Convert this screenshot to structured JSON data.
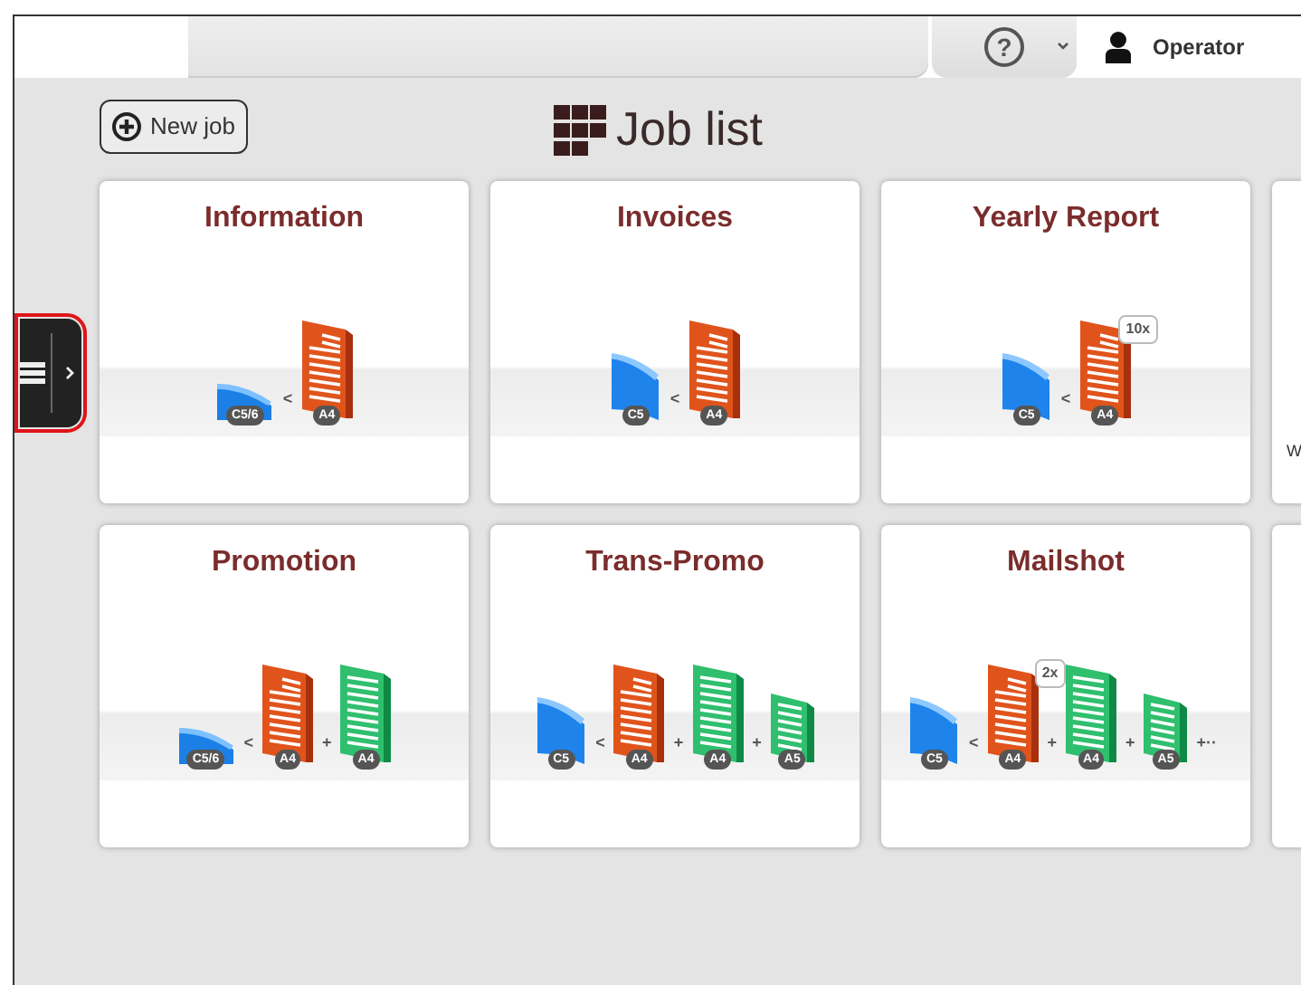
{
  "top_bar": {
    "help_symbol": "?",
    "user": "Operator"
  },
  "header": {
    "new_job": "New job",
    "title": "Job list"
  },
  "sidebar_handle": {
    "highlighted": true
  },
  "rows": [
    {
      "cards": [
        {
          "title": "Information",
          "items": [
            {
              "kind": "envelope-wide",
              "badge": "C5/6"
            },
            {
              "kind": "separator",
              "text": "<"
            },
            {
              "kind": "letter",
              "badge": "A4"
            }
          ]
        },
        {
          "title": "Invoices",
          "items": [
            {
              "kind": "envelope-tall",
              "badge": "C5"
            },
            {
              "kind": "separator",
              "text": "<"
            },
            {
              "kind": "letter",
              "badge": "A4"
            }
          ]
        },
        {
          "title": "Yearly Report",
          "items": [
            {
              "kind": "envelope-tall",
              "badge": "C5"
            },
            {
              "kind": "separator",
              "text": "<"
            },
            {
              "kind": "letter",
              "badge": "A4",
              "multiplier": "10x"
            }
          ]
        }
      ],
      "partial_card": {
        "text": "W"
      }
    },
    {
      "cards": [
        {
          "title": "Promotion",
          "items": [
            {
              "kind": "envelope-wide",
              "badge": "C5/6"
            },
            {
              "kind": "separator",
              "text": "<"
            },
            {
              "kind": "letter",
              "badge": "A4"
            },
            {
              "kind": "separator",
              "text": "+"
            },
            {
              "kind": "insert",
              "badge": "A4"
            }
          ]
        },
        {
          "title": "Trans-Promo",
          "items": [
            {
              "kind": "envelope-tall",
              "badge": "C5"
            },
            {
              "kind": "separator",
              "text": "<"
            },
            {
              "kind": "letter",
              "badge": "A4"
            },
            {
              "kind": "separator",
              "text": "+"
            },
            {
              "kind": "insert",
              "badge": "A4"
            },
            {
              "kind": "separator",
              "text": "+"
            },
            {
              "kind": "insert-small",
              "badge": "A5"
            }
          ]
        },
        {
          "title": "Mailshot",
          "items": [
            {
              "kind": "envelope-tall",
              "badge": "C5"
            },
            {
              "kind": "separator",
              "text": "<"
            },
            {
              "kind": "letter",
              "badge": "A4",
              "multiplier": "2x"
            },
            {
              "kind": "separator",
              "text": "+"
            },
            {
              "kind": "insert",
              "badge": "A4"
            },
            {
              "kind": "separator",
              "text": "+"
            },
            {
              "kind": "insert-small",
              "badge": "A5"
            },
            {
              "kind": "separator",
              "text": "+··"
            }
          ]
        }
      ],
      "partial_card": {}
    }
  ]
}
